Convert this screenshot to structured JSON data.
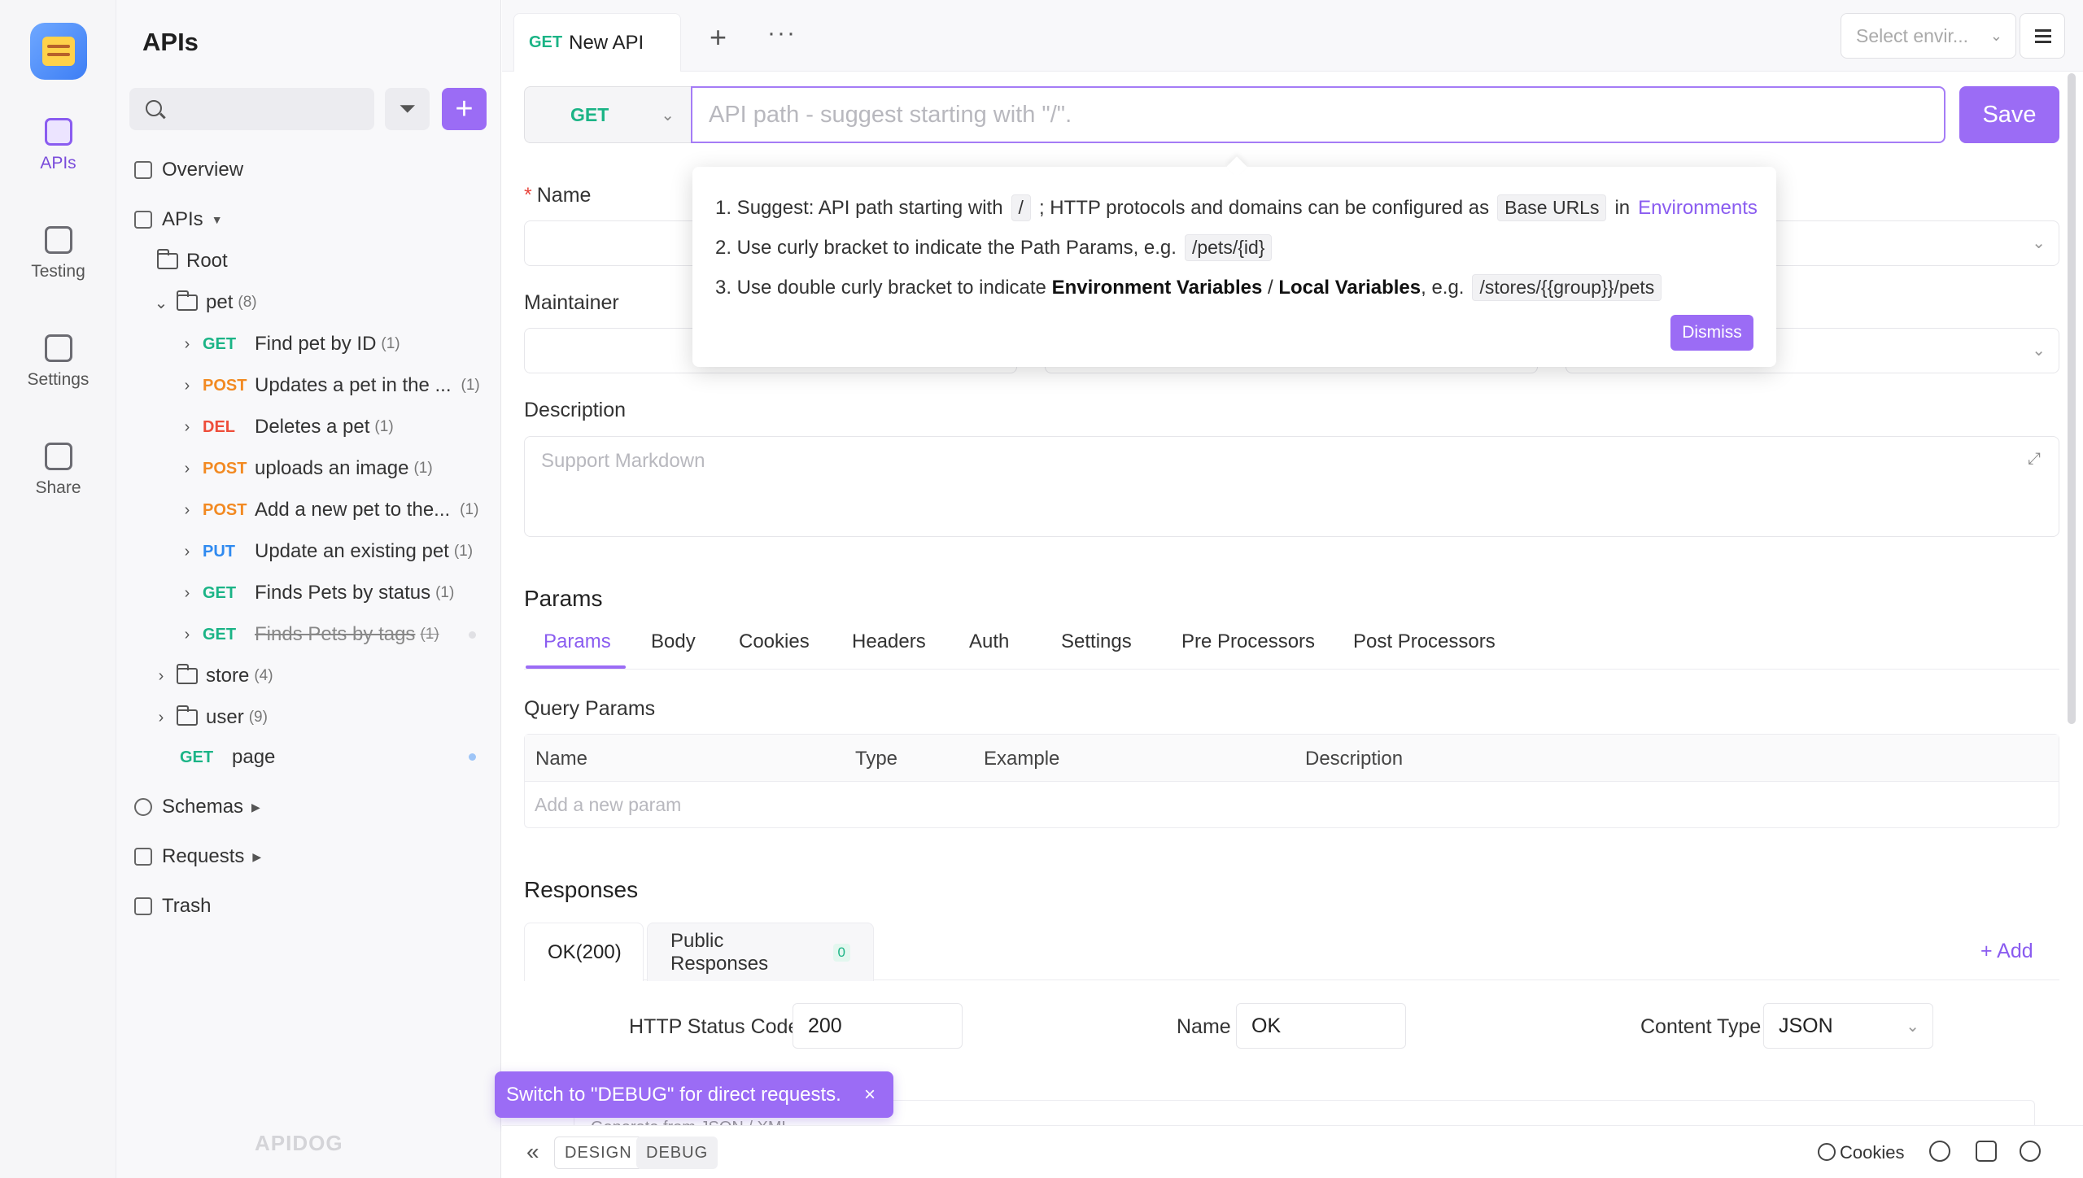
{
  "rail": {
    "items": [
      {
        "label": "APIs",
        "icon": "api-icon"
      },
      {
        "label": "Testing",
        "icon": "testing-icon"
      },
      {
        "label": "Settings",
        "icon": "settings-icon"
      },
      {
        "label": "Share",
        "icon": "share-icon"
      }
    ]
  },
  "sidebar": {
    "title": "APIs",
    "search_placeholder": "",
    "overview": "Overview",
    "apis_label": "APIs",
    "root": "Root",
    "pet": {
      "name": "pet",
      "count": "(8)"
    },
    "pet_items": [
      {
        "method": "GET",
        "name": "Find pet by ID",
        "count": "(1)"
      },
      {
        "method": "POST",
        "name": "Updates a pet in the ...",
        "count": "(1)"
      },
      {
        "method": "DEL",
        "name": "Deletes a pet",
        "count": "(1)"
      },
      {
        "method": "POST",
        "name": "uploads an image",
        "count": "(1)"
      },
      {
        "method": "POST",
        "name": "Add a new pet to the...",
        "count": "(1)"
      },
      {
        "method": "PUT",
        "name": "Update an existing pet",
        "count": "(1)"
      },
      {
        "method": "GET",
        "name": "Finds Pets by status",
        "count": "(1)"
      },
      {
        "method": "GET",
        "name": "Finds Pets by tags",
        "count": "(1)"
      }
    ],
    "store": {
      "name": "store",
      "count": "(4)"
    },
    "user": {
      "name": "user",
      "count": "(9)"
    },
    "page_item": {
      "method": "GET",
      "name": "page"
    },
    "schemas": "Schemas",
    "requests": "Requests",
    "trash": "Trash",
    "watermark": "APIDOG"
  },
  "tabbar": {
    "tab_method": "GET",
    "tab_label": "New API",
    "env_placeholder": "Select envir..."
  },
  "request": {
    "method": "GET",
    "path_placeholder": "API path - suggest starting with \"/\".",
    "save_label": "Save"
  },
  "form": {
    "name_label": "Name",
    "maintainer_label": "Maintainer",
    "description_label": "Description",
    "description_placeholder": "Support Markdown"
  },
  "popover": {
    "line1_a": "1. Suggest: API path starting with",
    "line1_chip": "/",
    "line1_b": "; HTTP protocols and domains can be configured as",
    "line1_chip2": "Base URLs",
    "line1_c": "in",
    "line1_link": "Environments",
    "line2_a": "2. Use curly bracket to indicate the Path Params, e.g.",
    "line2_chip": "/pets/{id}",
    "line3_a": "3. Use double curly bracket to indicate",
    "line3_b1": "Environment Variables",
    "line3_sep": "/",
    "line3_b2": "Local Variables",
    "line3_c": ", e.g.",
    "line3_chip": "/stores/{{group}}/pets",
    "dismiss": "Dismiss"
  },
  "params": {
    "title": "Params",
    "tabs": [
      "Params",
      "Body",
      "Cookies",
      "Headers",
      "Auth",
      "Settings",
      "Pre Processors",
      "Post Processors"
    ],
    "query_title": "Query Params",
    "columns": [
      "Name",
      "Type",
      "Example",
      "Description"
    ],
    "add_placeholder": "Add a new param"
  },
  "responses": {
    "title": "Responses",
    "tab_ok": "OK(200)",
    "tab_public": "Public Responses",
    "public_count": "0",
    "add": "+ Add",
    "status_label": "HTTP Status Code",
    "status_value": "200",
    "name_label": "Name",
    "name_value": "OK",
    "content_label": "Content Type",
    "content_value": "JSON",
    "generate_hint": "Generate from JSON / XML"
  },
  "toast": {
    "text": "Switch to \"DEBUG\" for direct requests.",
    "close": "×"
  },
  "footer": {
    "design": "DESIGN",
    "debug": "DEBUG",
    "cookies": "Cookies"
  },
  "colors": {
    "accent": "#9b6cf5",
    "get": "#1bb486",
    "post": "#f28a22",
    "del": "#ee4d3a",
    "put": "#2f8af0"
  }
}
